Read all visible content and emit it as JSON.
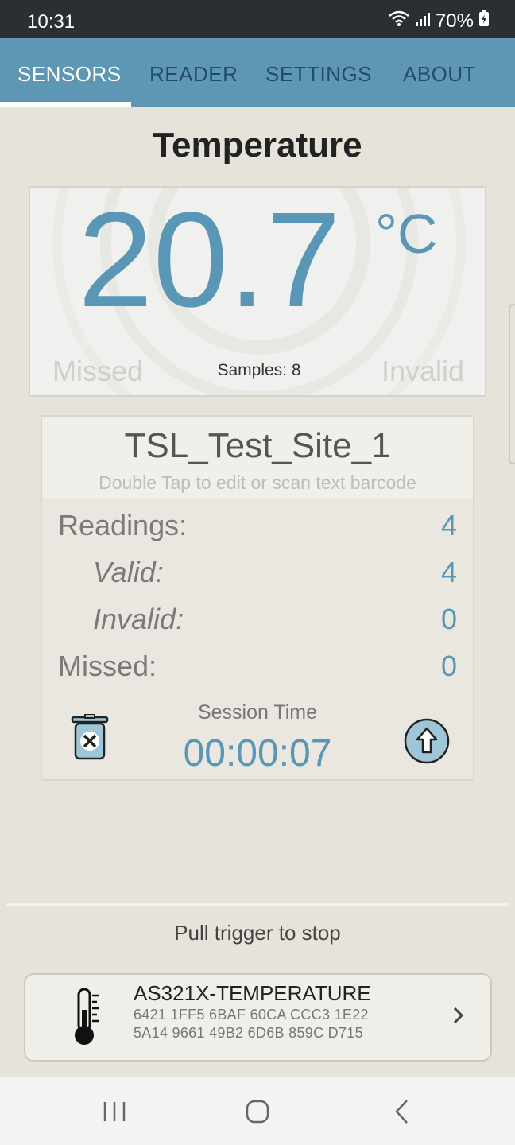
{
  "status_bar": {
    "time": "10:31",
    "battery": "70%"
  },
  "tabs": [
    {
      "label": "SENSORS",
      "active": true
    },
    {
      "label": "READER",
      "active": false
    },
    {
      "label": "SETTINGS",
      "active": false
    },
    {
      "label": "ABOUT",
      "active": false
    }
  ],
  "sensor": {
    "title": "Temperature",
    "value": "20.7",
    "unit": "°C",
    "missed_label": "Missed",
    "invalid_label": "Invalid",
    "samples": "Samples: 8"
  },
  "session": {
    "site_name": "TSL_Test_Site_1",
    "site_hint": "Double Tap to edit or scan text barcode",
    "stats": {
      "readings": {
        "label": "Readings:",
        "value": "4"
      },
      "valid": {
        "label": "Valid:",
        "value": "4"
      },
      "invalid": {
        "label": "Invalid:",
        "value": "0"
      },
      "missed": {
        "label": "Missed:",
        "value": "0"
      }
    },
    "time_label": "Session Time",
    "time_value": "00:00:07"
  },
  "pull_trigger": "Pull trigger to stop",
  "tag": {
    "name": "AS321X-TEMPERATURE",
    "epc_line1": "6421 1FF5 6BAF 60CA CCC3 1E22",
    "epc_line2": "5A14 9661 49B2 6D6B 859C D715"
  },
  "icons": {
    "trash": "delete-session-icon",
    "upload": "upload-icon",
    "thermometer": "thermometer-icon",
    "chevron": "chevron-right-icon"
  },
  "colors": {
    "accent": "#5a97b6",
    "tabbar": "#5d97b4",
    "background": "#e6e4da"
  }
}
